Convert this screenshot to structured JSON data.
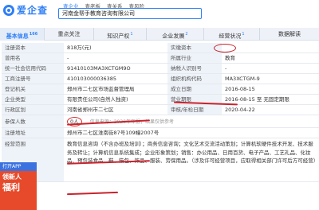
{
  "brand": {
    "name": "爱企查",
    "logo": "aiqicha-logo-icon"
  },
  "search": {
    "tabs": [
      "查企业",
      "查老板",
      "查关系",
      "查风险"
    ],
    "query": "河南金帮手教育咨询有限公司"
  },
  "nav": [
    {
      "label": "基本信息",
      "count": "166",
      "active": true
    },
    {
      "label": "重点关注",
      "count": "",
      "active": false
    },
    {
      "label": "知识产权",
      "count": "1",
      "active": false
    },
    {
      "label": "企业发展",
      "count": "2",
      "active": false
    },
    {
      "label": "经营状况",
      "count": "1",
      "active": false
    },
    {
      "label": "数据解读",
      "count": "",
      "active": false
    }
  ],
  "rows": [
    {
      "l1": "注册资本",
      "v1": "818万(元)",
      "l2": "实缴资本",
      "v2": ""
    },
    {
      "l1": "曾用名",
      "v1": "-",
      "l2": "所属行业",
      "v2": "教育"
    },
    {
      "l1": "统一社会信用代码",
      "v1": "91410103MA3XCTGM9O",
      "l2": "纳税人识别号",
      "v2": "-"
    },
    {
      "l1": "工商注册号",
      "v1": "410103000036385",
      "l2": "组织机构代码",
      "v2": "MA3XCTGM-9"
    },
    {
      "l1": "登记机关",
      "v1": "郑州市二七区市场监督管理局",
      "l2": "成立日期",
      "v2": "2016-08-15"
    },
    {
      "l1": "企业类型",
      "v1": "有限责任公司(自然人独资)",
      "l2": "营业期限",
      "v2": "2016-08-15 至 无固定期限"
    },
    {
      "l1": "行政区划",
      "v1": "河南省郑州市二七区",
      "l2": "审核/年检日期",
      "v2": "2020-04-22"
    }
  ],
  "employees": {
    "label": "参保人数",
    "value": "0人",
    "note": "信息来源：2020年年报，结果仅供参考"
  },
  "address": {
    "label": "注册地址",
    "value": "郑州市二七区淮南街87号109幢2007号"
  },
  "scope": {
    "label": "经营范围",
    "value": "教育信息咨询（不含办班及培训）；商务信息咨询；文化艺术交流活动策划；计算机软硬件技术开发、技术服务及转让；计算机信息系统集成；企业形象策划；销售：办公用品、日用百货、电子产品、工艺礼品、化妆品、预包装食品、鞋、箱包、饰品、服装、劳保用品。（涉及许可经营项目，应取得相关部门许可后方可经营）"
  },
  "side_ad": {
    "top": "打开APP",
    "mid": "领新人",
    "big": "福利"
  },
  "colors": {
    "accent": "#2f7ff5",
    "annotation": "#c8232c"
  }
}
